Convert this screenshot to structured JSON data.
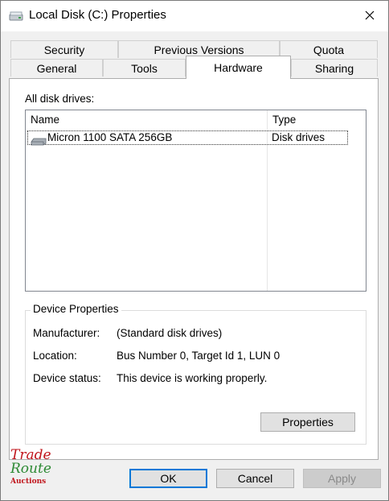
{
  "window": {
    "title": "Local Disk (C:) Properties"
  },
  "tabs_top": [
    "Security",
    "Previous Versions",
    "Quota"
  ],
  "tabs_bottom": [
    "General",
    "Tools",
    "Hardware",
    "Sharing"
  ],
  "active_tab": "Hardware",
  "hardware": {
    "all_drives_label": "All disk drives:",
    "columns": [
      "Name",
      "Type"
    ],
    "rows": [
      {
        "name": "Micron 1100 SATA 256GB",
        "type": "Disk drives"
      }
    ],
    "device_properties": {
      "title": "Device Properties",
      "fields": [
        {
          "label": "Manufacturer:",
          "value": "(Standard disk drives)"
        },
        {
          "label": "Location:",
          "value": "Bus Number 0, Target Id 1, LUN 0"
        },
        {
          "label": "Device status:",
          "value": "This device is working properly."
        }
      ],
      "properties_button": "Properties"
    }
  },
  "buttons": {
    "ok": "OK",
    "cancel": "Cancel",
    "apply": "Apply"
  },
  "watermark": {
    "line1": "Trade",
    "line2": "Route",
    "line3": "Auctions"
  },
  "colors": {
    "accent": "#0078d7",
    "panel_bg": "#f0f0f0",
    "selection_border": "#333333"
  },
  "icons": {
    "title": "drive-icon",
    "close": "close-icon",
    "row": "disk-drive-icon"
  }
}
